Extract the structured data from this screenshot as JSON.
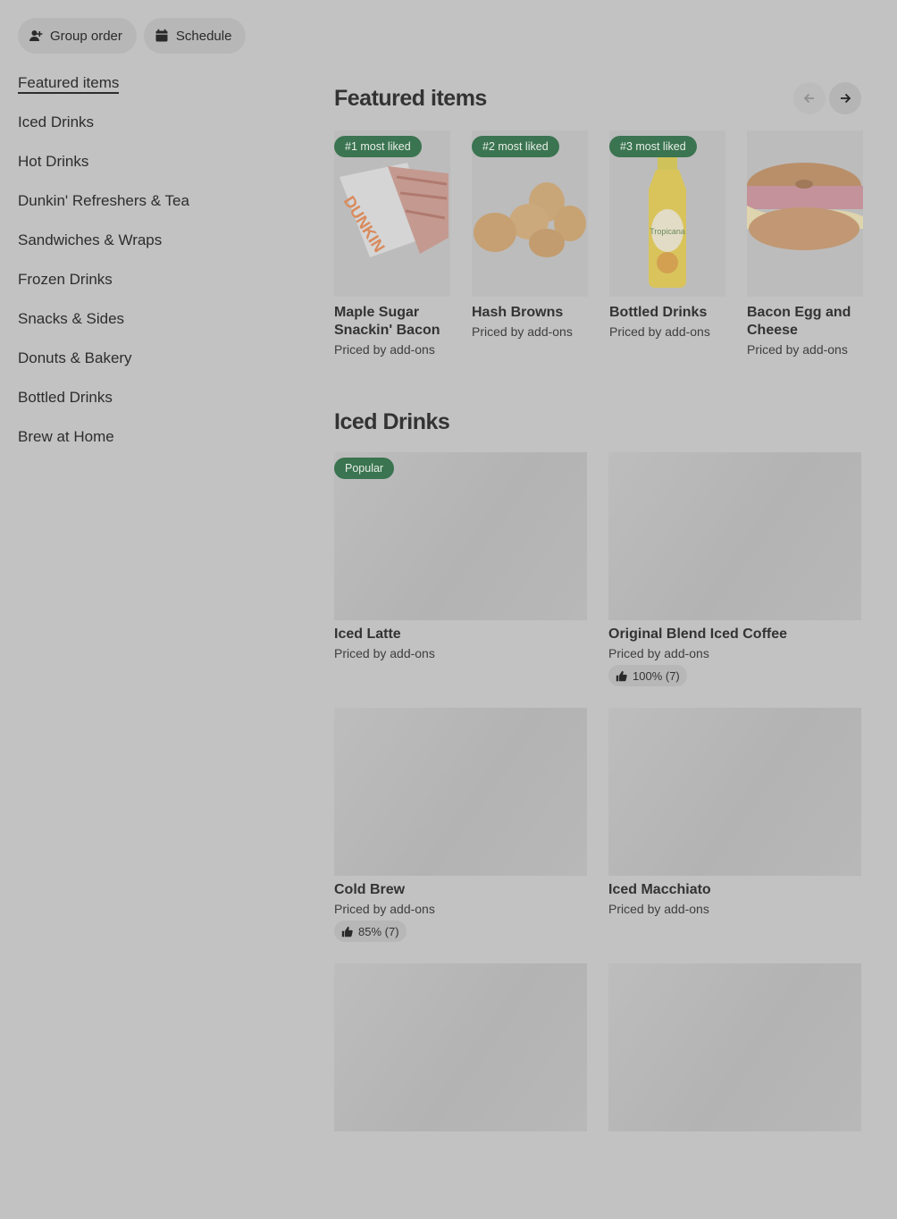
{
  "header": {
    "group_order_label": "Group order",
    "schedule_label": "Schedule"
  },
  "sidebar": {
    "items": [
      {
        "label": "Featured items"
      },
      {
        "label": "Iced Drinks"
      },
      {
        "label": "Hot Drinks"
      },
      {
        "label": "Dunkin' Refreshers & Tea"
      },
      {
        "label": "Sandwiches & Wraps"
      },
      {
        "label": "Frozen Drinks"
      },
      {
        "label": "Snacks & Sides"
      },
      {
        "label": "Donuts & Bakery"
      },
      {
        "label": "Bottled Drinks"
      },
      {
        "label": "Brew at Home"
      }
    ]
  },
  "featured": {
    "title": "Featured items",
    "items": [
      {
        "badge": "#1 most liked",
        "name": "Maple Sugar Snackin' Bacon",
        "price": "Priced by add-ons"
      },
      {
        "badge": "#2 most liked",
        "name": "Hash Browns",
        "price": "Priced by add-ons"
      },
      {
        "badge": "#3 most liked",
        "name": "Bottled Drinks",
        "price": "Priced by add-ons"
      },
      {
        "badge": "",
        "name": "Bacon Egg and Cheese",
        "price": "Priced by add-ons"
      }
    ]
  },
  "iced": {
    "title": "Iced Drinks",
    "items": [
      {
        "badge": "Popular",
        "name": "Iced Latte",
        "price": "Priced by add-ons",
        "rating": ""
      },
      {
        "badge": "",
        "name": "Original Blend Iced Coffee",
        "price": "Priced by add-ons",
        "rating": "100% (7)"
      },
      {
        "badge": "",
        "name": "Cold Brew",
        "price": "Priced by add-ons",
        "rating": "85% (7)"
      },
      {
        "badge": "",
        "name": "Iced Macchiato",
        "price": "Priced by add-ons",
        "rating": ""
      }
    ]
  },
  "colors": {
    "badge_green": "#3a7450",
    "overlay_gray": "#c2c2c2"
  }
}
